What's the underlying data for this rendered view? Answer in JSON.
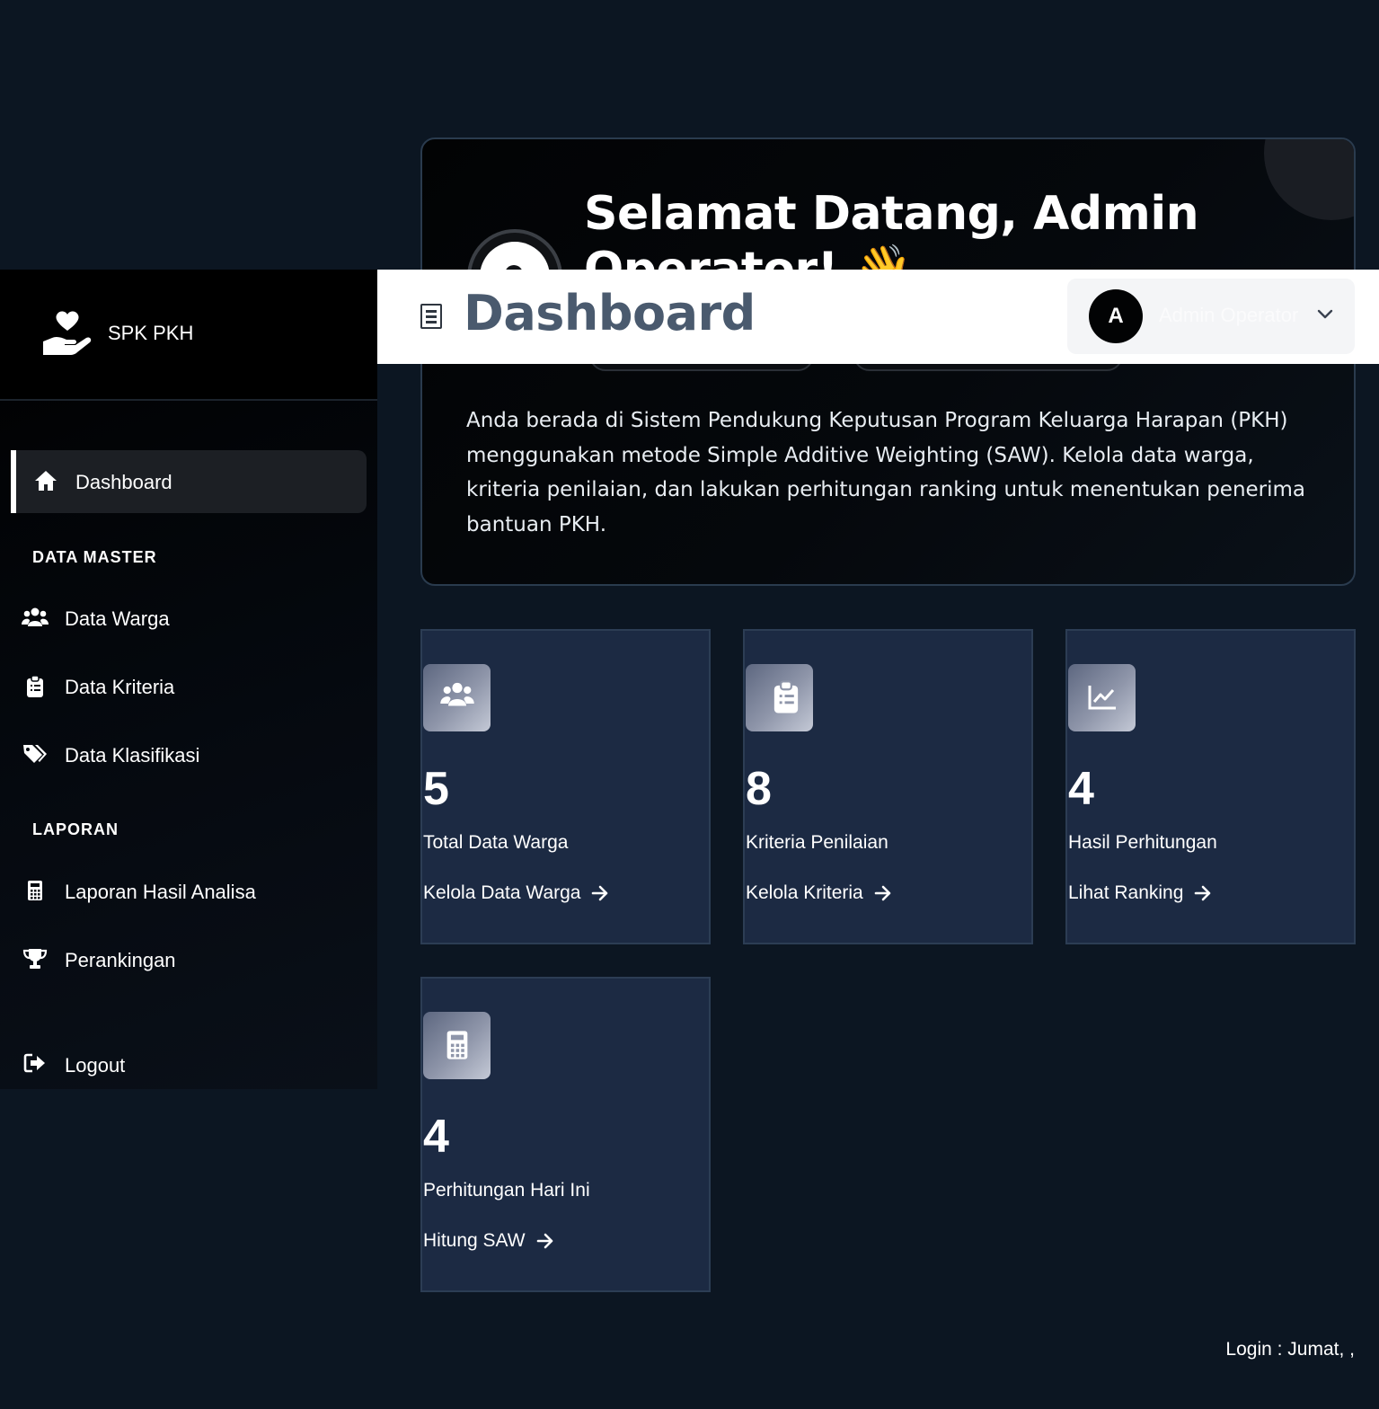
{
  "welcome": {
    "greeting": "Selamat Datang, Admin Operator! 👋",
    "description": "Anda berada di Sistem Pendukung Keputusan Program Keluarga Harapan (PKH) menggunakan metode Simple Additive Weighting (SAW). Kelola data warga, kriteria penilaian, dan lakukan perhitungan ranking untuk menentukan penerima bantuan PKH."
  },
  "header": {
    "title": "Dashboard",
    "menu_icon": "hamburger-icon",
    "user": {
      "initial": "A",
      "name": "Admin Operator",
      "dropdown_icon": "chevron-down-icon"
    }
  },
  "sidebar": {
    "brand": "SPK PKH",
    "brand_icon": "hand-heart-icon",
    "active_item": {
      "label": "Dashboard",
      "icon": "home-icon"
    },
    "sections": [
      {
        "title": "DATA MASTER",
        "items": [
          {
            "label": "Data Warga",
            "icon": "users-icon"
          },
          {
            "label": "Data Kriteria",
            "icon": "clipboard-list-icon"
          },
          {
            "label": "Data Klasifikasi",
            "icon": "tags-icon"
          }
        ]
      },
      {
        "title": "LAPORAN",
        "items": [
          {
            "label": "Laporan Hasil Analisa",
            "icon": "calculator-icon"
          },
          {
            "label": "Perankingan",
            "icon": "trophy-icon"
          }
        ]
      }
    ],
    "logout": {
      "label": "Logout",
      "icon": "sign-out-icon"
    }
  },
  "cards": [
    {
      "value": "5",
      "label": "Total Data Warga",
      "link": "Kelola Data Warga",
      "icon": "users-icon"
    },
    {
      "value": "8",
      "label": "Kriteria Penilaian",
      "link": "Kelola Kriteria",
      "icon": "clipboard-list-icon"
    },
    {
      "value": "4",
      "label": "Hasil Perhitungan",
      "link": "Lihat Ranking",
      "icon": "chart-line-icon"
    },
    {
      "value": "4",
      "label": "Perhitungan Hari Ini",
      "link": "Hitung SAW",
      "icon": "calculator-icon"
    }
  ],
  "footer": {
    "login_text": "Login : Jumat, ,"
  },
  "colors": {
    "background": "#0c1622",
    "card": "#1c2a43",
    "sidebar": "#000000",
    "header": "#ffffff"
  }
}
